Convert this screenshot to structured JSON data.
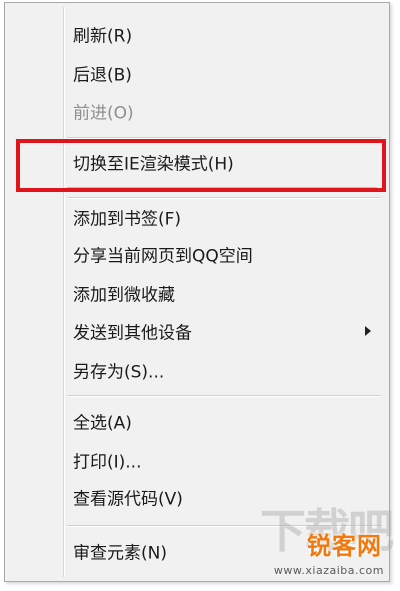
{
  "context_menu": {
    "items": [
      {
        "label": "刷新(R)",
        "enabled": true
      },
      {
        "label": "后退(B)",
        "enabled": true
      },
      {
        "label": "前进(O)",
        "enabled": false
      },
      {
        "label": "切换至IE渲染模式(H)",
        "enabled": true,
        "highlighted": true
      },
      {
        "label": "添加到书签(F)",
        "enabled": true
      },
      {
        "label": "分享当前网页到QQ空间",
        "enabled": true
      },
      {
        "label": "添加到微收藏",
        "enabled": true
      },
      {
        "label": "发送到其他设备",
        "enabled": true,
        "has_submenu": true
      },
      {
        "label": "另存为(S)...",
        "enabled": true
      },
      {
        "label": "全选(A)",
        "enabled": true
      },
      {
        "label": "打印(I)...",
        "enabled": true
      },
      {
        "label": "查看源代码(V)",
        "enabled": true
      },
      {
        "label": "审查元素(N)",
        "enabled": true
      }
    ],
    "submenu_arrow_icon": "triangle-right-icon",
    "highlight_box_color": "#e0141b"
  },
  "watermark": {
    "brand": "锐客网",
    "faint_text": "下载吧",
    "url": "www.xiazaiba.com"
  }
}
